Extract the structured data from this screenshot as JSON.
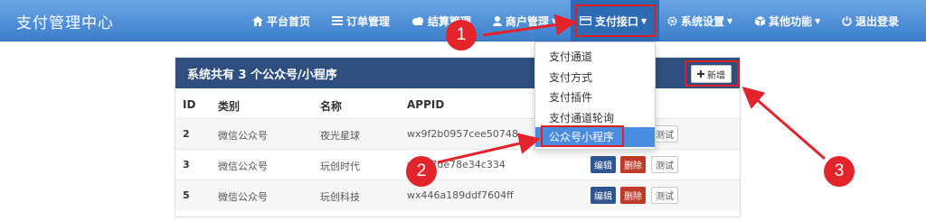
{
  "brand": "支付管理中心",
  "nav": {
    "home": "平台首页",
    "orders": "订单管理",
    "settle": "结算管理",
    "merchant": "商户管理",
    "payment": "支付接口",
    "settings": "系统设置",
    "other": "其他功能",
    "logout": "退出登录"
  },
  "panel": {
    "title": "系统共有 3 个公众号/小程序",
    "add_label": "新增",
    "columns": [
      "ID",
      "类别",
      "名称",
      "APPID"
    ]
  },
  "rows": [
    {
      "id": "2",
      "type": "微信公众号",
      "name": "夜光星球",
      "appid": "wx9f2b0957cee50748"
    },
    {
      "id": "3",
      "type": "微信公众号",
      "name": "玩创时代",
      "appid": "wx7f7de78e34c334"
    },
    {
      "id": "5",
      "type": "微信公众号",
      "name": "玩创科技",
      "appid": "wx446a189ddf7604ff"
    }
  ],
  "actions": {
    "edit": "编辑",
    "delete": "删除",
    "test": "测试"
  },
  "dropdown": [
    "支付通道",
    "支付方式",
    "支付插件",
    "支付通道轮询",
    "公众号小程序"
  ],
  "markers": [
    "1",
    "2",
    "3"
  ],
  "colors": {
    "navbar": "#4a8de0",
    "panel_head": "#2e4f7f",
    "edit": "#2f5690",
    "delete": "#c0392b",
    "annotation": "#e3242b"
  }
}
